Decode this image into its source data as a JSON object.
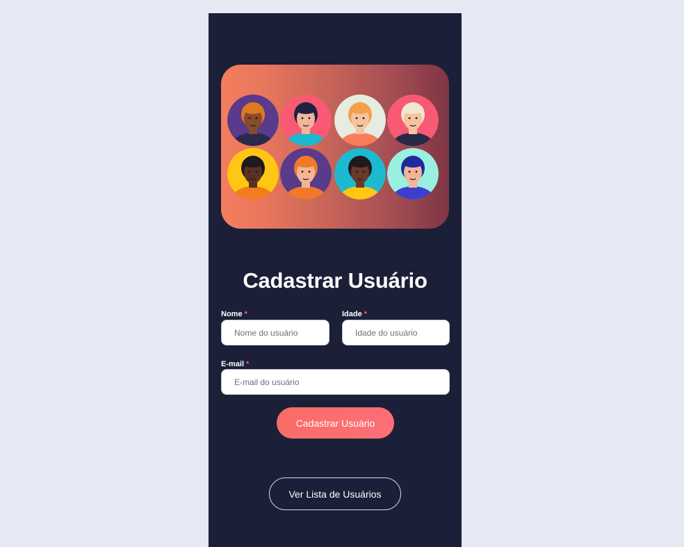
{
  "form": {
    "title": "Cadastrar Usuário",
    "required_mark": "*",
    "name": {
      "label": "Nome",
      "placeholder": "Nome do usuário",
      "value": ""
    },
    "age": {
      "label": "Idade",
      "placeholder": "Idade do usuário",
      "value": ""
    },
    "email": {
      "label": "E-mail",
      "placeholder": "E-mail do usuário",
      "value": ""
    },
    "submit_label": "Cadastrar Usuário"
  },
  "nav": {
    "list_users_label": "Ver Lista de Usuários"
  },
  "banner": {
    "avatars": [
      {
        "name": "avatar-curly-hair-woman",
        "bg": "#5a3a8a",
        "skin": "#8a4a2c",
        "hair": "#e07820",
        "shirt": "#2a2a4a"
      },
      {
        "name": "avatar-cap-woman",
        "bg": "#f75a72",
        "skin": "#f4b49a",
        "hair": "#1f2240",
        "shirt": "#1bb8d0"
      },
      {
        "name": "avatar-ponytail-woman",
        "bg": "#e7ece0",
        "skin": "#f6c3a0",
        "hair": "#f0a04a",
        "shirt": "#f87c5a"
      },
      {
        "name": "avatar-blond-man",
        "bg": "#f75a72",
        "skin": "#f6c3a0",
        "hair": "#f3e6d0",
        "shirt": "#262a48"
      },
      {
        "name": "avatar-glasses-man",
        "bg": "#ffc713",
        "skin": "#5a3222",
        "hair": "#1e1a20",
        "shirt": "#f47c1c"
      },
      {
        "name": "avatar-redhead-man",
        "bg": "#5a3a8a",
        "skin": "#f6b592",
        "hair": "#f07a2a",
        "shirt": "#f07a2a"
      },
      {
        "name": "avatar-hoodie-man",
        "bg": "#1cb9cf",
        "skin": "#6a3a2a",
        "hair": "#1e1a20",
        "shirt": "#ffc713"
      },
      {
        "name": "avatar-bearded-man",
        "bg": "#9af0e0",
        "skin": "#f4b49a",
        "hair": "#1e2aa0",
        "shirt": "#3a3fd0"
      }
    ]
  }
}
